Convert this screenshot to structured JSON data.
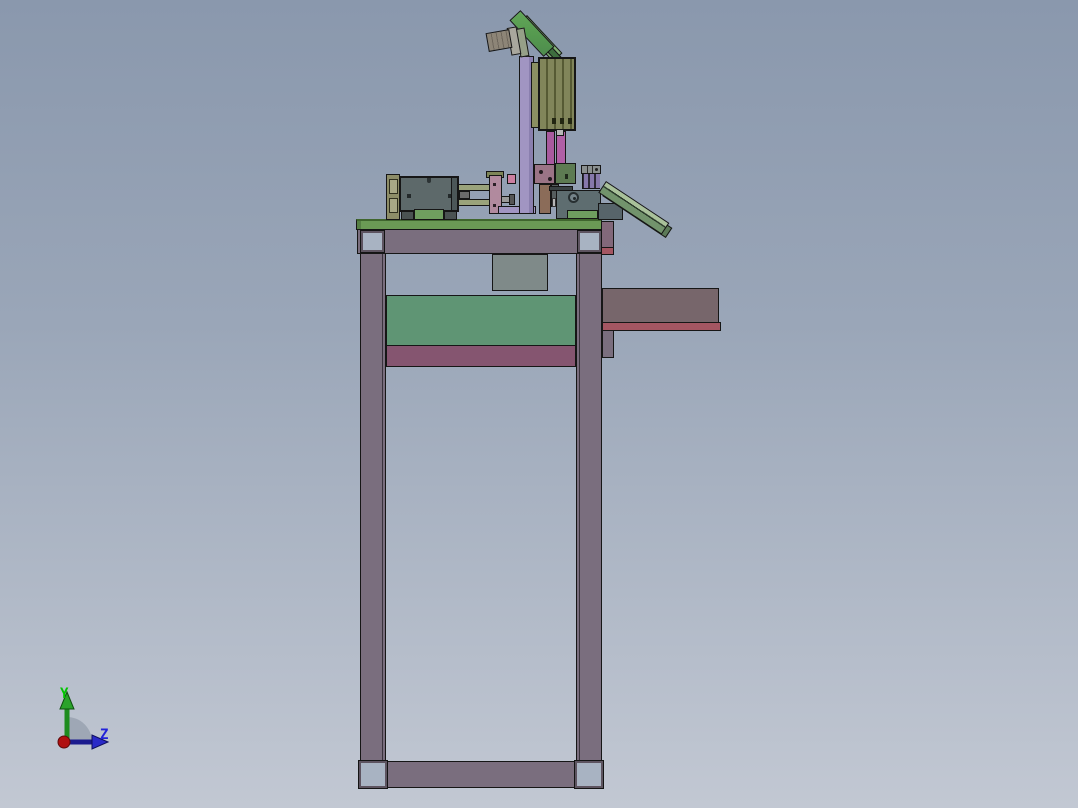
{
  "app": {
    "type": "cad-3d-viewport",
    "view_orientation": "side"
  },
  "axis_triad": {
    "labels": {
      "y": "Y",
      "z": "Z"
    },
    "colors": {
      "y_label": "#00C400",
      "y_arrow": "#1e8c1e",
      "z_label": "#2323D9",
      "z_arrow": "#2a2ac8",
      "origin_x": "#B01010",
      "arc": "#99A2B0"
    }
  },
  "background": {
    "top": "#8A98AD",
    "bottom": "#C2C8D3"
  },
  "palette": {
    "frame": "#7A6E7E",
    "tabletop_green": "#6B9A55",
    "foot_light": "#A8B3C2",
    "panel_green": "#5F9574",
    "panel_maroon": "#855570",
    "inner_gray": "#7F8A89",
    "shelf_brown": "#77666B",
    "shelf_red": "#A45662",
    "shelf_strip": "#82687A",
    "motor_gray": "#5D696A",
    "foot_green": "#6F9E5F",
    "bracket_olive": "#8D8D68",
    "bracket_notch": "#A8A886",
    "rod_olive": "#9AA37B",
    "plate_mauve": "#B18A9E",
    "plate_cap_olive": "#7D8557",
    "pink_block": "#CC7FA0",
    "column_lavender": "#A195C2",
    "cylinder_olive": "#7B7F52",
    "cylinder_side": "#8B8F62",
    "rod_magenta_a": "#A85A9E",
    "rod_magenta_b": "#B05FA5",
    "block_brown": "#9B7486",
    "block_dark_green": "#5D7B52",
    "cols_purple": "#8678AB",
    "striped_gray": "#8A8F8F",
    "arm_brown": "#8B6C59",
    "mid_dark": "#565E5F",
    "base_gray": "#5E6D70",
    "base_step": "#57646A",
    "bar_light": "#A9C19A",
    "bar_dark": "#72936C",
    "bar_back": "#5C7A58",
    "tilt_green": "#55994F",
    "tilt_green_light": "#7FAF72",
    "tilt_green_dark": "#3E6E3E",
    "cyl_tan": "#8D8577",
    "cyl_flange": "#A9A79D",
    "cyl_disc": "#96A088",
    "shaft_gray": "#9A9A9A",
    "dark_feet": "#4A5252"
  }
}
